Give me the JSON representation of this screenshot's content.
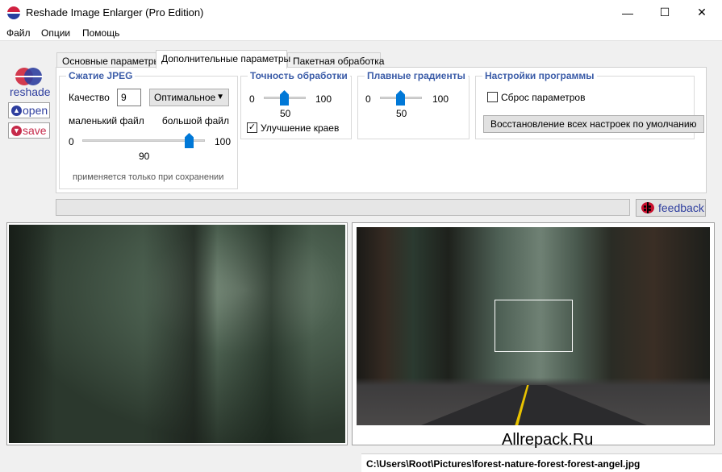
{
  "window": {
    "title": "Reshade Image Enlarger (Pro Edition)",
    "controls": {
      "minimize": "—",
      "maximize": "☐",
      "close": "✕"
    }
  },
  "menu": [
    "Файл",
    "Опции",
    "Помощь"
  ],
  "brand": {
    "logo_text": "reshade",
    "open_label": "open",
    "save_label": "save"
  },
  "tabs": [
    "Основные параметры",
    "Дополнительные параметры",
    "Пакетная обработка"
  ],
  "active_tab": 1,
  "jpeg": {
    "title": "Сжатие JPEG",
    "quality_label": "Качество",
    "quality_value": "9",
    "preset": "Оптимальное",
    "small_label": "маленький файл",
    "large_label": "большой файл",
    "min": "0",
    "max": "100",
    "value": "90",
    "note": "применяется только при сохранении"
  },
  "accuracy": {
    "title": "Точность обработки",
    "min": "0",
    "max": "100",
    "value": "50",
    "edge_label": "Улучшение краев",
    "edge_checked": true
  },
  "gradients": {
    "title": "Плавные градиенты",
    "min": "0",
    "max": "100",
    "value": "50"
  },
  "settings": {
    "title": "Настройки программы",
    "reset_label": "Сброс параметров",
    "reset_checked": false,
    "restore_button": "Восстановление всех настроек по умолчанию"
  },
  "feedback_label": "feedback",
  "watermark": "Allrepack.Ru",
  "status_path": "C:\\Users\\Root\\Pictures\\forest-nature-forest-forest-angel.jpg"
}
